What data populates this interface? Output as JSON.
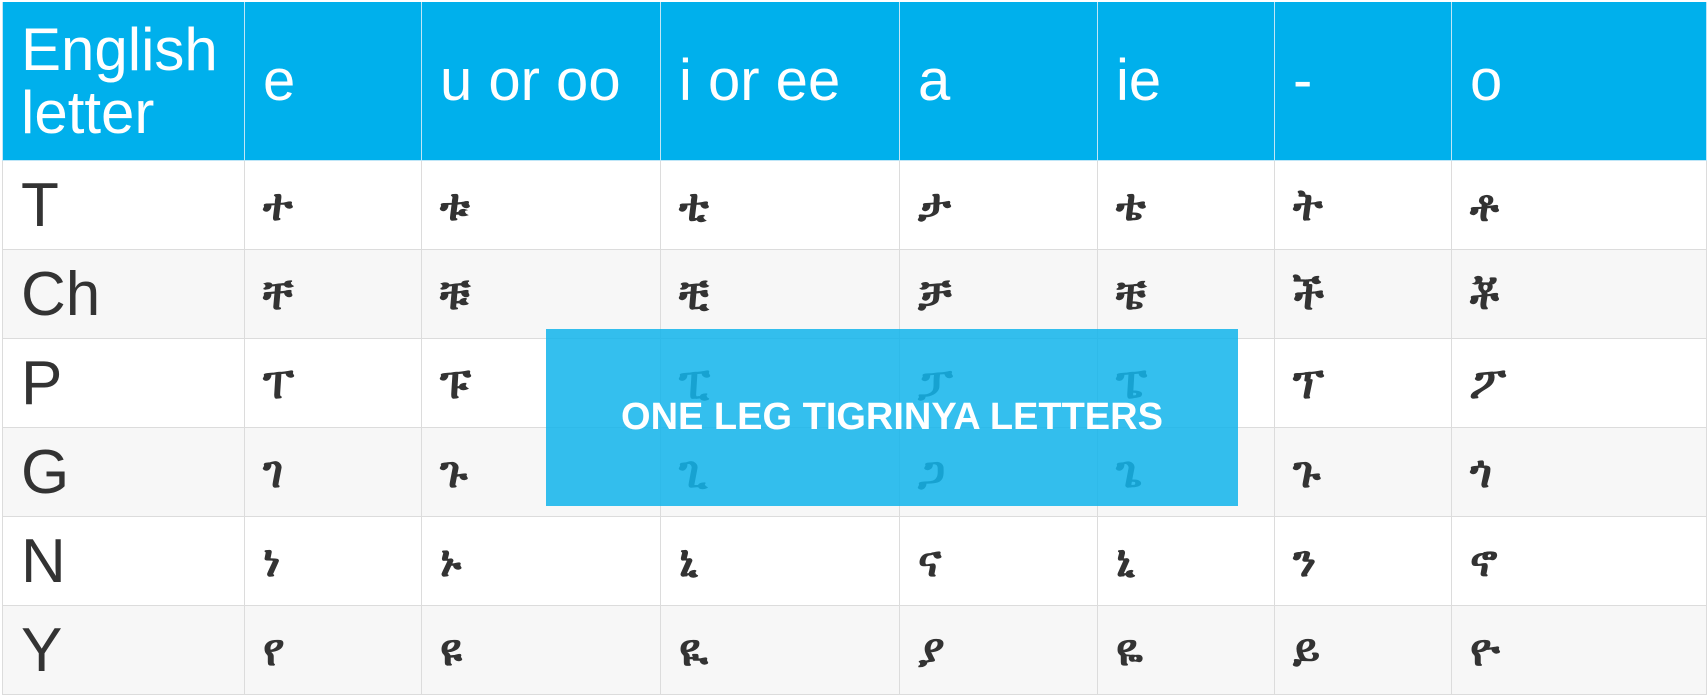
{
  "headers": [
    "English letter",
    "e",
    "u or oo",
    "i or ee",
    "a",
    "ie",
    "-",
    "o"
  ],
  "rows": [
    {
      "letter": "T",
      "forms": [
        "ተ",
        "ቱ",
        "ቲ",
        "ታ",
        "ቴ",
        "ት",
        "ቶ"
      ]
    },
    {
      "letter": "Ch",
      "forms": [
        "ቸ",
        "ቹ",
        "ቺ",
        "ቻ",
        "ቼ",
        "ች",
        "ቾ"
      ]
    },
    {
      "letter": "P",
      "forms": [
        "ፐ",
        "ፑ",
        "ፒ",
        "ፓ",
        "ፔ",
        "ፕ",
        "ፖ"
      ]
    },
    {
      "letter": "G",
      "forms": [
        "ገ",
        "ጉ",
        "ጊ",
        "ጋ",
        "ጌ",
        "ጉ",
        "ጎ"
      ]
    },
    {
      "letter": "N",
      "forms": [
        "ነ",
        "ኑ",
        "ኒ",
        "ና",
        "ኒ",
        "ን",
        "ኖ"
      ]
    },
    {
      "letter": "Y",
      "forms": [
        "የ",
        "ዩ",
        "ዪ",
        "ያ",
        "ዬ",
        "ይ",
        "ዮ"
      ]
    }
  ],
  "banner": {
    "text": "ONE LEG TIGRINYA LETTERS"
  },
  "colors": {
    "header_bg": "#00b0ec",
    "banner_bg": "#13b5eb",
    "text": "#333333"
  }
}
